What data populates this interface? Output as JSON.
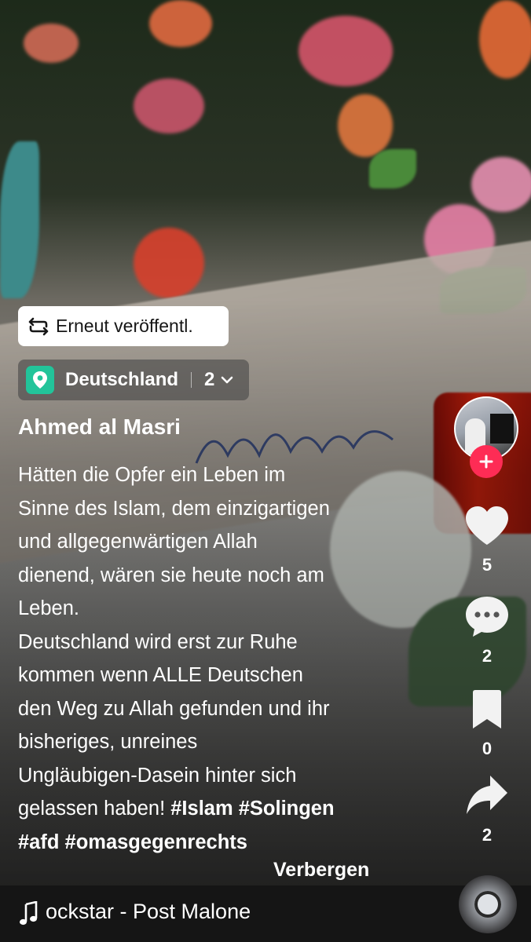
{
  "repost": {
    "label": "Erneut veröffentl."
  },
  "location": {
    "name": "Deutschland",
    "count": "2"
  },
  "author": {
    "name": "Ahmed al Masri"
  },
  "caption": {
    "lines": [
      "Hätten die Opfer ein Leben im",
      "Sinne des Islam, dem einzigartigen",
      "und allgegenwärtigen Allah",
      "dienend, wären sie heute noch am",
      "Leben.",
      "Deutschland wird erst zur Ruhe",
      "kommen wenn ALLE Deutschen",
      "den Weg zu Allah gefunden und ihr",
      "bisheriges, unreines",
      "Ungläubigen-Dasein hinter sich"
    ],
    "line11_text": "gelassen haben! ",
    "line11_tags": "#Islam #Solingen",
    "line12_tags": "#afd #omasgegenrechts",
    "hide_label": "Verbergen"
  },
  "actions": {
    "likes": "5",
    "comments": "2",
    "saves": "0",
    "shares": "2"
  },
  "music": {
    "track": "ockstar - Post Malone"
  },
  "icons": {
    "repost": "repost-icon",
    "location": "location-pin-icon",
    "follow": "plus-icon",
    "like": "heart-icon",
    "comment": "comment-bubble-icon",
    "save": "bookmark-icon",
    "share": "share-arrow-icon",
    "music": "music-note-icon"
  },
  "colors": {
    "follow": "#fe2c55",
    "location_pin": "#22c49a",
    "music_bar": "#151515"
  }
}
